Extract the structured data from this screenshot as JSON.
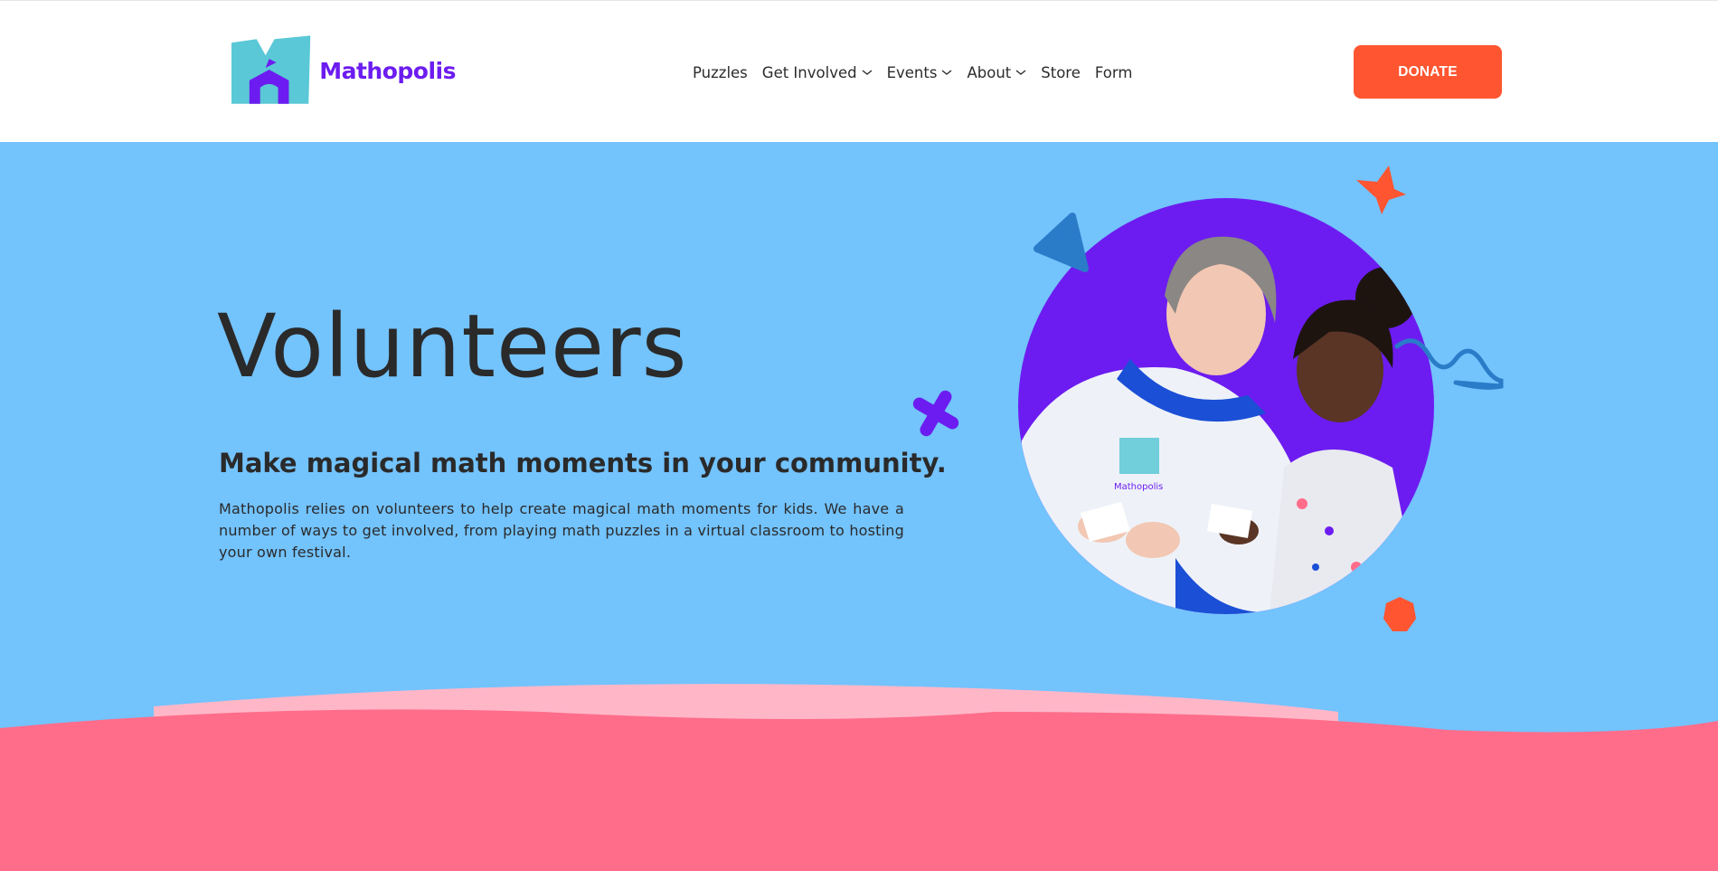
{
  "brand": {
    "name": "Mathopolis",
    "colors": {
      "primary": "#6c1cf0",
      "teal": "#5ac8d6",
      "accent": "#ff5531",
      "hero_bg": "#73c3fd",
      "pink": "#ff6d8b",
      "light_pink": "#ffb7c8"
    }
  },
  "nav": {
    "items": [
      {
        "label": "Puzzles",
        "has_dropdown": false
      },
      {
        "label": "Get Involved",
        "has_dropdown": true
      },
      {
        "label": "Events",
        "has_dropdown": true
      },
      {
        "label": "About",
        "has_dropdown": true
      },
      {
        "label": "Store",
        "has_dropdown": false
      },
      {
        "label": "Form",
        "has_dropdown": false
      }
    ],
    "dropdown_icon": "chevron-down-icon"
  },
  "donate": {
    "label": "DONATE"
  },
  "hero": {
    "title": "Volunteers",
    "subtitle": "Make magical math moments in your community.",
    "body": "Mathopolis relies on volunteers to help create magical math moments for kids. We have a number of ways to get involved, from playing math puzzles in a virtual classroom to hosting your own festival.",
    "photo_shirt_logo": "Mathopolis",
    "decorations": [
      "triangle-shape",
      "star-shape",
      "plus-shape",
      "squiggle-shape",
      "hexagon-shape"
    ]
  }
}
